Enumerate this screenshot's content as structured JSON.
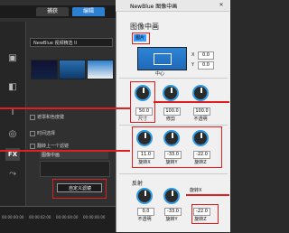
{
  "left": {
    "tabs": {
      "capture": "捕获",
      "edit": "编辑"
    },
    "filter_combo": "NewBlue 视频精选 II",
    "rows": [
      "遮罩和色度键",
      "时间选择",
      "翻转上一个滤镜"
    ],
    "selected_filter": "图像中画",
    "custom_filter_button": "自定义滤镜",
    "timestamps": [
      "00:00:00:00",
      "00:00:02:00",
      "00:00:04:00",
      "00:00:06:00",
      "00:00:08:00"
    ]
  },
  "dialog": {
    "title": "NewBlue  图像中画",
    "heading": "图像中画",
    "picture_badge": "图片",
    "center_label": "中心",
    "x_label": "X",
    "x_value": "0.0",
    "y_label": "Y",
    "y_value": "0.0",
    "size_row": [
      {
        "label": "尺寸",
        "value": "50.0"
      },
      {
        "label": "修剪",
        "value": "100.0"
      },
      {
        "label": "不透明",
        "value": "100.0"
      }
    ],
    "rotate_row": [
      {
        "label": "旋转X",
        "value": "11.0"
      },
      {
        "label": "旋转Y",
        "value": "-33.0"
      },
      {
        "label": "旋转Z",
        "value": "-22.0"
      }
    ],
    "reflection_label": "反射",
    "reflection_row": [
      {
        "label": "不透明",
        "value": "0.0"
      },
      {
        "label": "旋转Y",
        "value": "-33.0"
      },
      {
        "label": "旋转Z",
        "value": "-22.0"
      }
    ],
    "rotate_x_label": "旋转X"
  },
  "colors": {
    "accent": "#2f9be0",
    "highlight": "#e02020",
    "edit_tab": "#2d7fd0"
  }
}
